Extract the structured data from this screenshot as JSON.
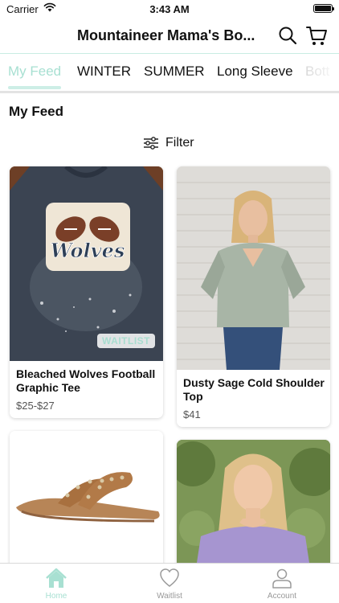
{
  "status_bar": {
    "carrier": "Carrier",
    "time": "3:43 AM"
  },
  "header": {
    "title": "Mountaineer Mama's Bo..."
  },
  "tabs": [
    {
      "label": "My Feed",
      "active": true
    },
    {
      "label": "WINTER",
      "active": false
    },
    {
      "label": "SUMMER",
      "active": false
    },
    {
      "label": "Long Sleeve",
      "active": false
    },
    {
      "label": "Bott",
      "active": false
    }
  ],
  "feed": {
    "title": "My Feed",
    "filter_label": "Filter"
  },
  "products": [
    {
      "name": "Bleached Wolves Football Graphic Tee",
      "price": "$25-$27",
      "badge": "WAITLIST",
      "graphic_text": "Wolves"
    },
    {
      "name": "Dusty Sage Cold Shoulder Top",
      "price": "$41"
    },
    {
      "name": "",
      "price": ""
    },
    {
      "name": "",
      "price": ""
    }
  ],
  "bottom_nav": {
    "home": "Home",
    "waitlist": "Waitlist",
    "account": "Account"
  },
  "colors": {
    "accent": "#a8e0d2",
    "accent_light": "#cdeee6",
    "text": "#111111",
    "muted": "#999999"
  }
}
